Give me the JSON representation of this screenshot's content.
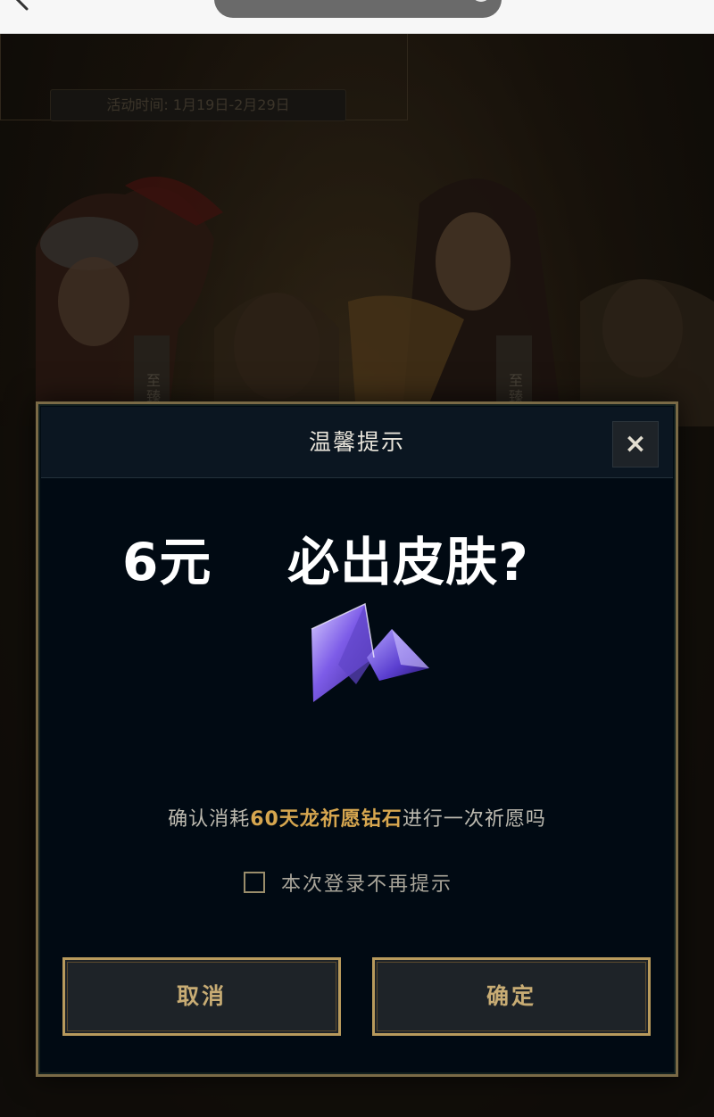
{
  "browser": {
    "url_text": "· · · · · · · · ·  ···  ···",
    "icons": [
      "chevron-left-icon",
      "circle-icon"
    ]
  },
  "background": {
    "event_time": "活动时间: 1月19日-2月29日",
    "badge_left": "至臻",
    "badge_right": "至臻"
  },
  "dialog": {
    "title": "温馨提示",
    "close_label": "×",
    "headline": "6元    必出皮肤?",
    "confirm_prefix": "确认消耗",
    "confirm_highlight": "60天龙祈愿钻石",
    "confirm_suffix": "进行一次祈愿吗",
    "checkbox_label": "本次登录不再提示",
    "cancel_label": "取消",
    "ok_label": "确定",
    "icons": [
      "close-icon",
      "wish-gem-icon",
      "checkbox-icon"
    ]
  },
  "colors": {
    "accent_gold": "#b89a5c",
    "highlight": "#d6a64f",
    "dialog_bg": "#010a13",
    "button_bg": "#1e2328"
  }
}
